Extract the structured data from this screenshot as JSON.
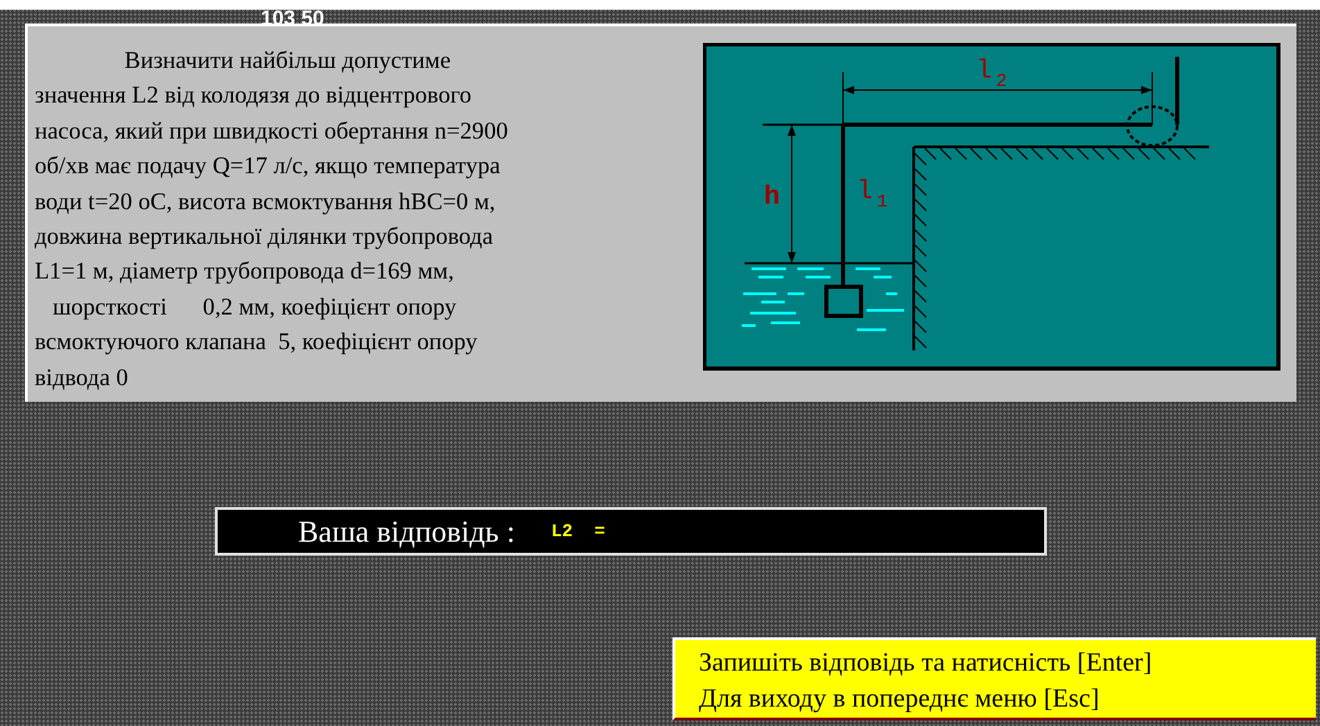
{
  "header_number": "103 50",
  "problem": {
    "lines": [
      "               Визначити найбільш допустиме",
      "значення L2 від колодязя до відцентрового",
      "насоса, який при швидкості обертання n=2900",
      "об/хв має подачу Q=17 л/с, якщо температура",
      "води t=20 оС, висота всмоктування hВС=0 м,",
      "довжина вертикальної ділянки трубопровода",
      "L1=1 м, діаметр трубопровода d=169 мм,",
      "   шорсткості      0,2 мм, коефіцієнт опору",
      "всмоктуючого клапана  5, коефіцієнт опору",
      "відвода 0"
    ]
  },
  "diagram": {
    "labels": [
      {
        "kind": "height",
        "text": "h"
      },
      {
        "kind": "vertical_length",
        "text": "l",
        "subscript": "1"
      },
      {
        "kind": "horizontal_length",
        "text": "l",
        "subscript": "2"
      }
    ]
  },
  "answer": {
    "label": "Ваша відповідь :",
    "prompt": "L2  ="
  },
  "hints": [
    "Запишіть відповідь та натисність [Enter]",
    "Для виходу в попереднє меню [Esc]"
  ]
}
